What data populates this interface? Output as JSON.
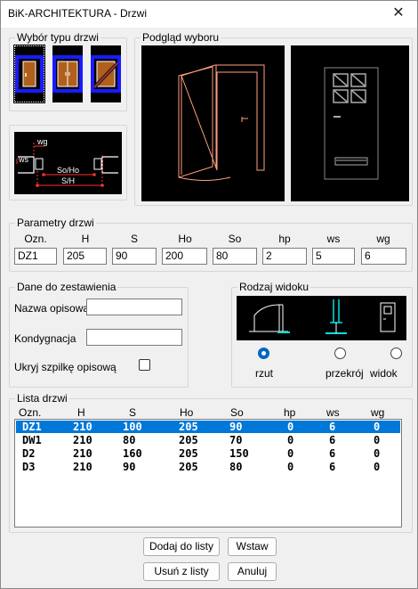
{
  "window": {
    "title": "BiK-ARCHITEKTURA -  Drzwi",
    "close_glyph": "✕"
  },
  "type_group": {
    "label": "Wybór typu drzwi"
  },
  "preview_group": {
    "label": "Podgląd wyboru"
  },
  "dims_diagram": {
    "wg": "wg",
    "ws": "ws",
    "so_ho": "So/Ho",
    "sh": "S/H"
  },
  "params": {
    "label": "Parametry drzwi",
    "headers": [
      "Ozn.",
      "H",
      "S",
      "Ho",
      "So",
      "hp",
      "ws",
      "wg"
    ],
    "values": [
      "DZ1",
      "205",
      "90",
      "200",
      "80",
      "2",
      "5",
      "6"
    ]
  },
  "zest": {
    "label": "Dane do zestawienia",
    "nazwa_label": "Nazwa opisowa",
    "nazwa_value": "",
    "kond_label": "Kondygnacja",
    "kond_value": "",
    "ukryj_label": "Ukryj szpilkę opisową"
  },
  "view": {
    "label": "Rodzaj widoku",
    "options": [
      "rzut",
      "przekrój",
      "widok"
    ],
    "selected": "rzut"
  },
  "list": {
    "label": "Lista drzwi",
    "headers": [
      "Ozn.",
      "H",
      "S",
      "Ho",
      "So",
      "hp",
      "ws",
      "wg"
    ],
    "rows": [
      [
        "DZ1",
        "210",
        "100",
        "205",
        "90",
        "0",
        "6",
        "0"
      ],
      [
        "DW1",
        "210",
        "80",
        "205",
        "70",
        "0",
        "6",
        "0"
      ],
      [
        "D2",
        "210",
        "160",
        "205",
        "150",
        "0",
        "6",
        "0"
      ],
      [
        "D3",
        "210",
        "90",
        "205",
        "80",
        "0",
        "6",
        "0"
      ]
    ],
    "selected_index": 0
  },
  "buttons": {
    "add": "Dodaj do listy",
    "insert": "Wstaw",
    "remove": "Usuń z listy",
    "cancel": "Anuluj"
  },
  "colors": {
    "accent": "#0078d7",
    "door_line": "#ff9f7f",
    "dim_red": "#ff0000",
    "cyan": "#00e0e0"
  }
}
